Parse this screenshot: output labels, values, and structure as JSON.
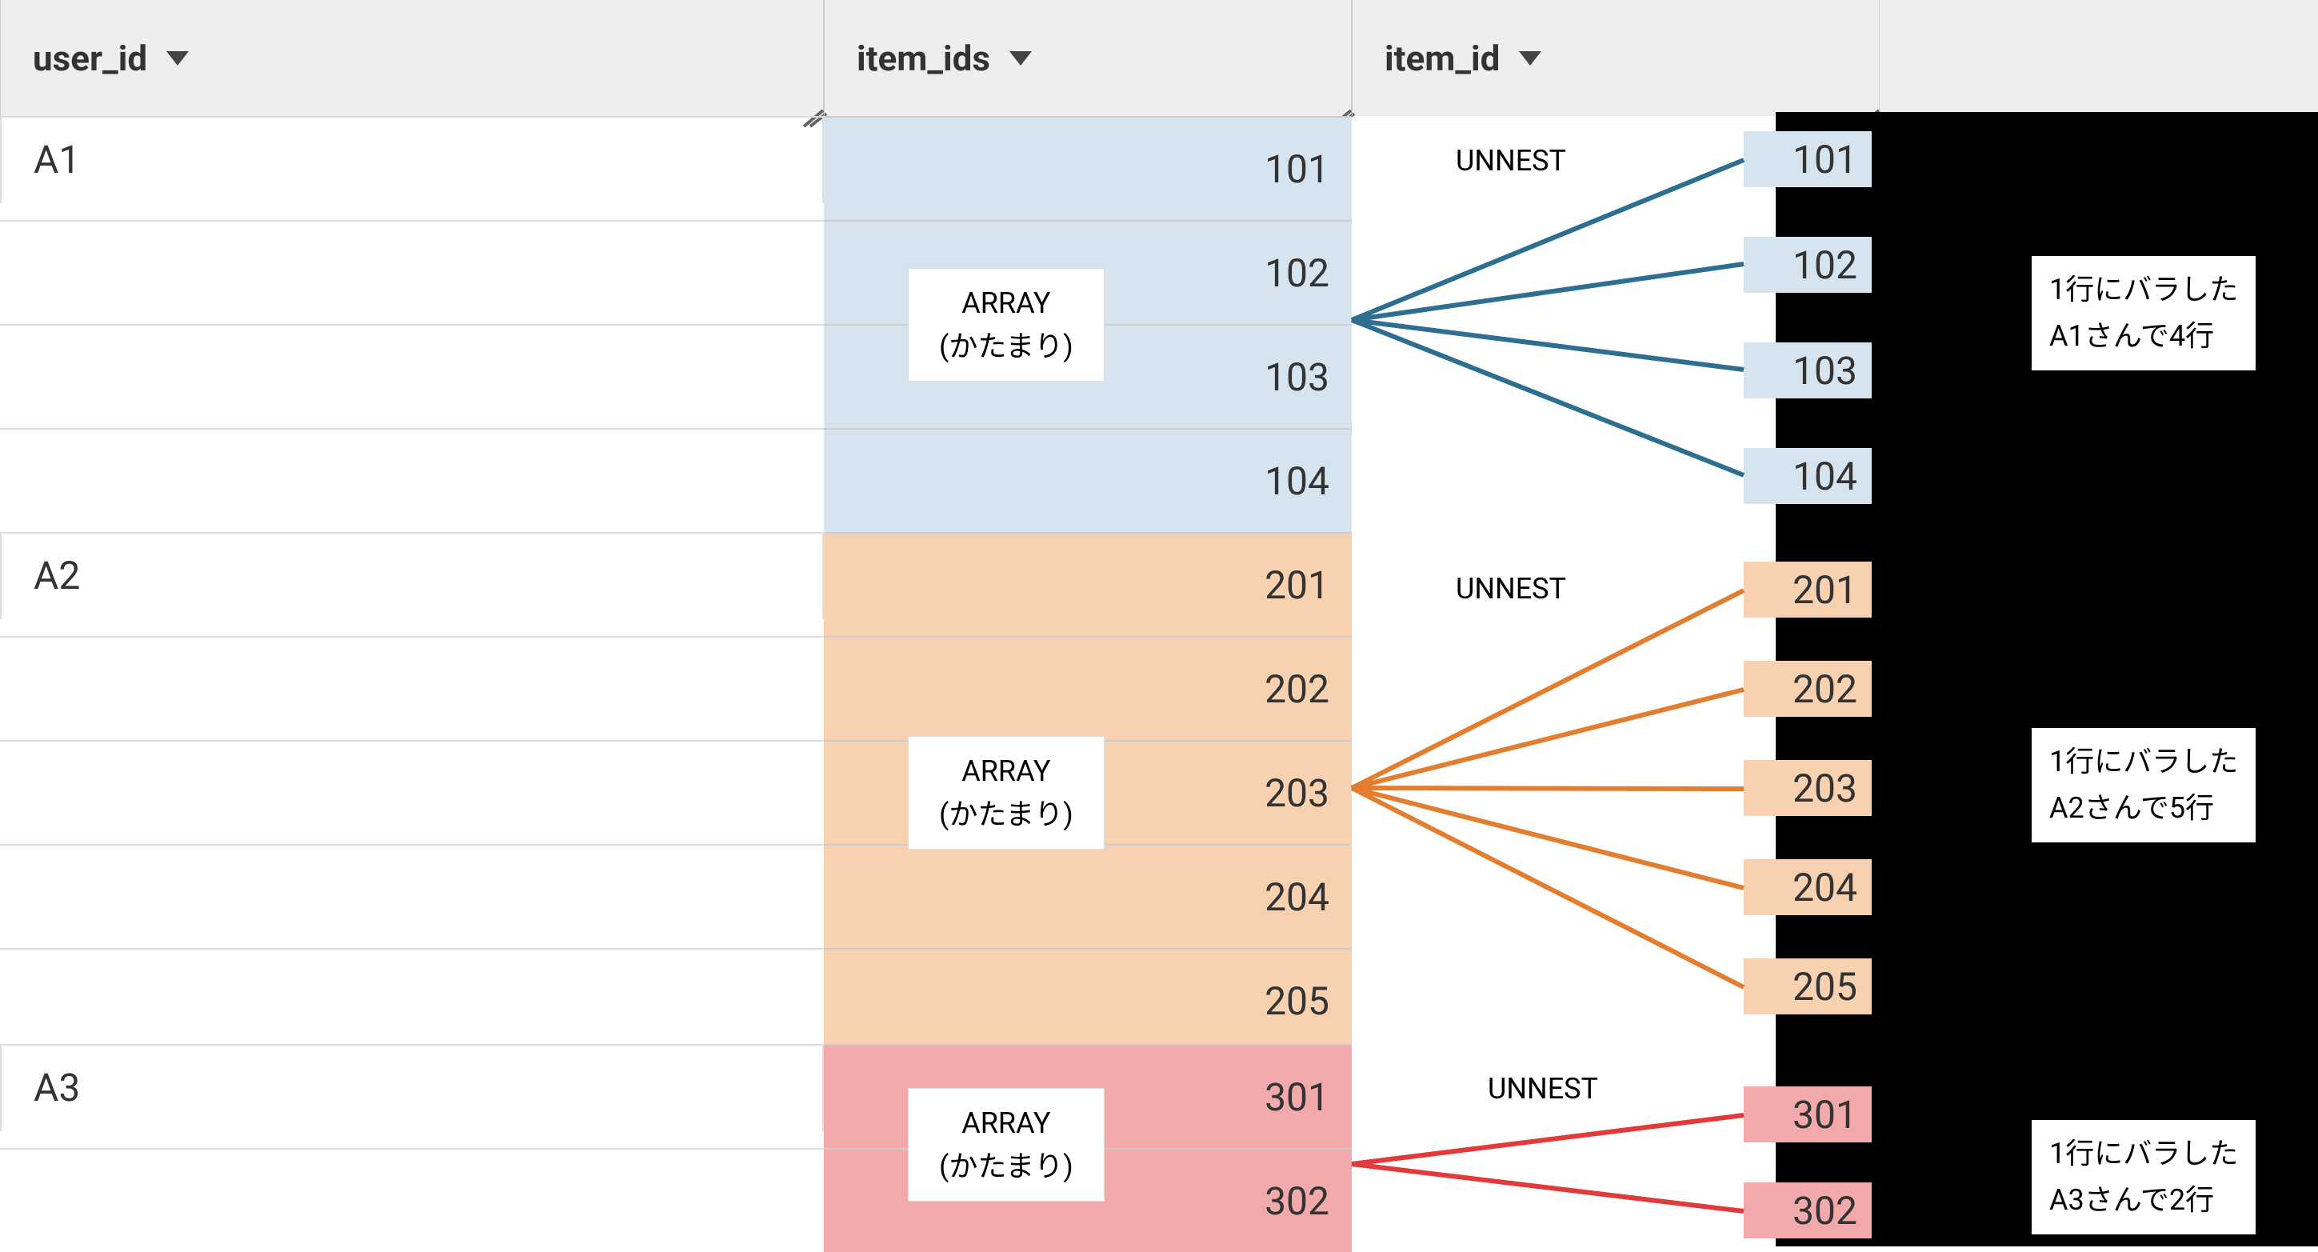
{
  "headers": {
    "col1": "user_id",
    "col2": "item_ids",
    "col3": "item_id"
  },
  "users": {
    "a1": "A1",
    "a2": "A2",
    "a3": "A3"
  },
  "arrays": {
    "label_line1": "ARRAY",
    "label_line2": "(かたまり)",
    "a1": [
      "101",
      "102",
      "103",
      "104"
    ],
    "a2": [
      "201",
      "202",
      "203",
      "204",
      "205"
    ],
    "a3": [
      "301",
      "302"
    ]
  },
  "unnest_label": "UNNEST",
  "chips": {
    "a1": [
      "101",
      "102",
      "103",
      "104"
    ],
    "a2": [
      "201",
      "202",
      "203",
      "204",
      "205"
    ],
    "a3": [
      "301",
      "302"
    ]
  },
  "callouts": {
    "a1": {
      "line1": "1行にバラした",
      "line2": "A1さんで4行"
    },
    "a2": {
      "line1": "1行にバラした",
      "line2": "A2さんで5行"
    },
    "a3": {
      "line1": "1行にバラした",
      "line2": "A3さんで2行"
    }
  }
}
